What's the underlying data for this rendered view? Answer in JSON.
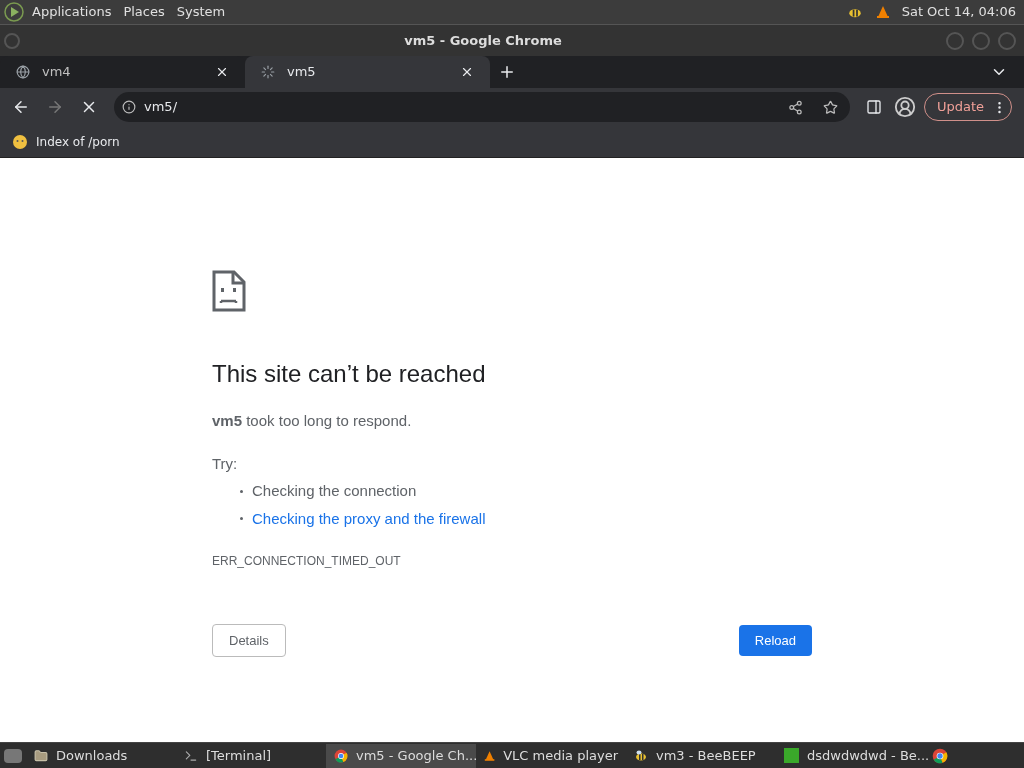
{
  "top_panel": {
    "menus": [
      "Applications",
      "Places",
      "System"
    ],
    "clock": "Sat Oct 14, 04:06"
  },
  "window": {
    "title": "vm5 - Google Chrome"
  },
  "tabs": [
    {
      "label": "vm4",
      "selected": false,
      "loading": false
    },
    {
      "label": "vm5",
      "selected": true,
      "loading": true
    }
  ],
  "toolbar": {
    "address": "vm5/",
    "update_button": "Update"
  },
  "bookmarks": [
    {
      "label": "Index of /porn"
    }
  ],
  "error_page": {
    "title": "This site can’t be reached",
    "message": "**vm5** took too long to respond.",
    "try_label": "Try:",
    "suggestions": [
      {
        "kind": "text",
        "text": "Checking the connection"
      },
      {
        "kind": "link",
        "text": "Checking the proxy and the firewall"
      }
    ],
    "error_code": "ERR_CONNECTION_TIMED_OUT",
    "details_button": "Details",
    "reload_button": "Reload"
  },
  "taskbar": [
    {
      "label": "Downloads",
      "kind": "folder",
      "selected": false
    },
    {
      "label": "[Terminal]",
      "kind": "terminal",
      "selected": false
    },
    {
      "label": "vm5 - Google Ch...",
      "kind": "chrome",
      "selected": true
    },
    {
      "label": "VLC media player",
      "kind": "vlc",
      "selected": false
    },
    {
      "label": "vm3 - BeeBEEP",
      "kind": "bee",
      "selected": false
    },
    {
      "label": "dsdwdwdwd - Be...",
      "kind": "ds",
      "selected": false
    }
  ]
}
